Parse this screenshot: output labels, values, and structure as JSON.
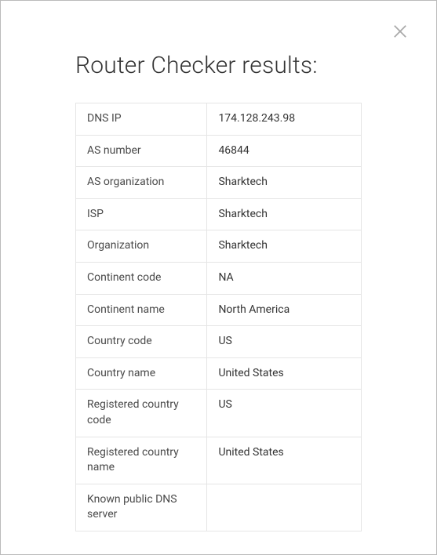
{
  "modal": {
    "title": "Router Checker results:",
    "rows": [
      {
        "label": "DNS IP",
        "value": "174.128.243.98"
      },
      {
        "label": "AS number",
        "value": "46844"
      },
      {
        "label": "AS organization",
        "value": "Sharktech"
      },
      {
        "label": "ISP",
        "value": "Sharktech"
      },
      {
        "label": "Organization",
        "value": "Sharktech"
      },
      {
        "label": "Continent code",
        "value": "NA"
      },
      {
        "label": "Continent name",
        "value": "North America"
      },
      {
        "label": "Country code",
        "value": "US"
      },
      {
        "label": "Country name",
        "value": "United States"
      },
      {
        "label": "Registered country code",
        "value": "US"
      },
      {
        "label": "Registered country name",
        "value": "United States"
      },
      {
        "label": "Known public DNS server",
        "value": ""
      }
    ]
  }
}
